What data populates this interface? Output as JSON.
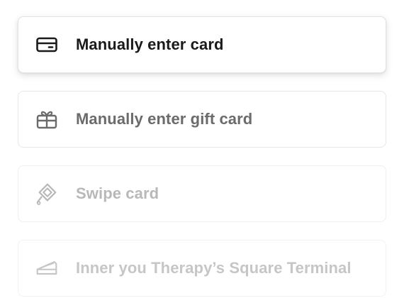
{
  "options": [
    {
      "label": "Manually enter card",
      "icon": "credit-card-icon",
      "state": "selected",
      "color": "#1a1a1a"
    },
    {
      "label": "Manually enter gift card",
      "icon": "gift-card-icon",
      "state": "enabled",
      "color": "#6b6b6b"
    },
    {
      "label": "Swipe card",
      "icon": "swipe-card-icon",
      "state": "disabled",
      "color": "#b8b8b8"
    },
    {
      "label": "Inner you Therapy’s Square Terminal",
      "icon": "terminal-icon",
      "state": "disabled",
      "color": "#c6c6c6"
    }
  ]
}
